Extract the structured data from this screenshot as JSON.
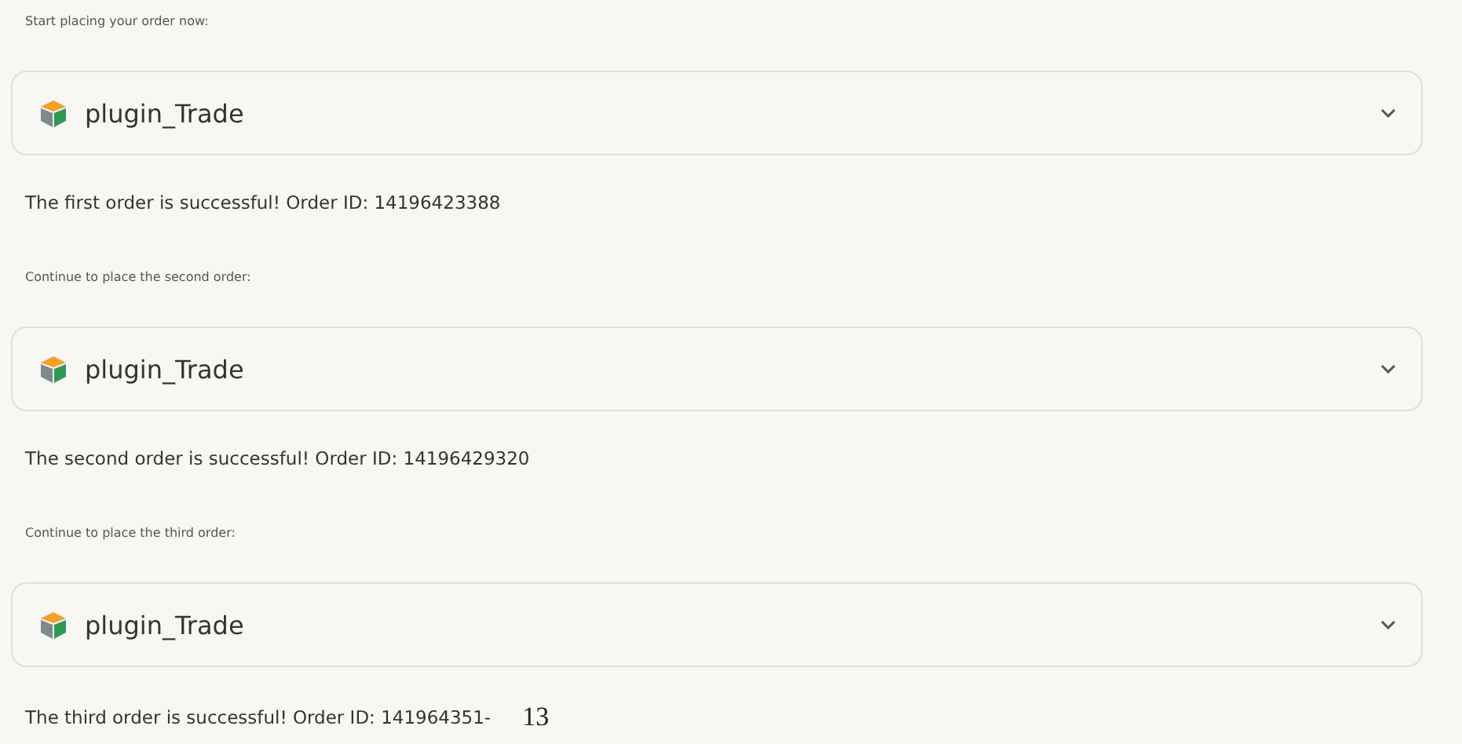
{
  "sections": [
    {
      "prompt": "Start placing your order now:",
      "select": {
        "value": "plugin_Trade"
      },
      "result": "The first order is successful! Order ID: 14196423388"
    },
    {
      "prompt": "Continue to place the second order:",
      "select": {
        "value": "plugin_Trade"
      },
      "result": "The second order is successful! Order ID: 14196429320"
    },
    {
      "prompt": "Continue to place the third order:",
      "select": {
        "value": "plugin_Trade"
      },
      "result": "The third order is successful! Order ID: 141964351-",
      "result_suffix": "13"
    }
  ]
}
